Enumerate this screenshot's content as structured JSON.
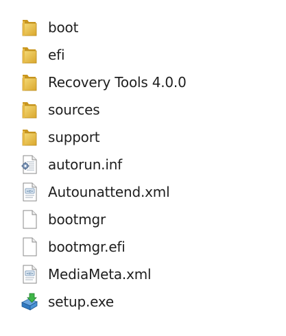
{
  "items": [
    {
      "name": "boot",
      "icon": "folder-icon"
    },
    {
      "name": "efi",
      "icon": "folder-icon"
    },
    {
      "name": "Recovery Tools 4.0.0",
      "icon": "folder-icon"
    },
    {
      "name": "sources",
      "icon": "folder-icon"
    },
    {
      "name": "support",
      "icon": "folder-icon"
    },
    {
      "name": "autorun.inf",
      "icon": "settings-file-icon"
    },
    {
      "name": "Autounattend.xml",
      "icon": "xml-file-icon"
    },
    {
      "name": "bootmgr",
      "icon": "blank-file-icon"
    },
    {
      "name": "bootmgr.efi",
      "icon": "blank-file-icon"
    },
    {
      "name": "MediaMeta.xml",
      "icon": "xml-file-icon"
    },
    {
      "name": "setup.exe",
      "icon": "setup-icon"
    }
  ],
  "colors": {
    "folder": "#e8c04a",
    "folder_dark": "#c9961e",
    "text": "#1e1e1e"
  }
}
